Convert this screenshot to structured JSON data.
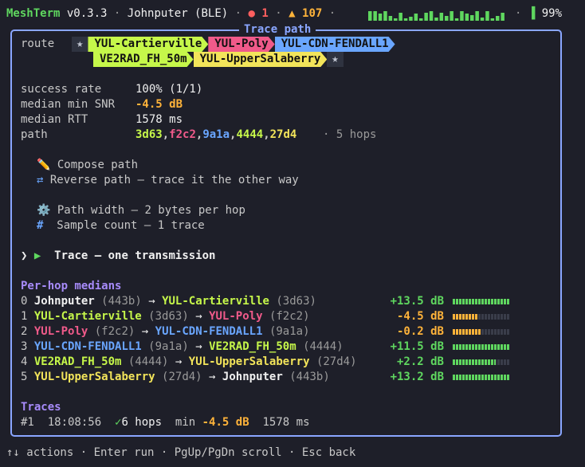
{
  "header": {
    "app": "MeshTerm",
    "version": "v0.3.3",
    "device": "Johnputer (BLE)",
    "errors": "1",
    "warnings": "107",
    "battery": "99%"
  },
  "frame_title": "Trace path",
  "route": {
    "label": "route",
    "star": "★",
    "row1": [
      "YUL-Cartierville",
      "YUL-Poly",
      "YUL-CDN-FENDALL1"
    ],
    "row2": [
      "VE2RAD_FH_50m",
      "YUL-UpperSalaberry"
    ]
  },
  "stats": {
    "success_label": "success rate",
    "success_value": "100% (1/1)",
    "snr_label": "median min SNR",
    "snr_value": "-4.5 dB",
    "rtt_label": "median RTT",
    "rtt_value": "1578 ms",
    "path_label": "path",
    "path_ids": [
      "3d63",
      "f2c2",
      "9a1a",
      "4444",
      "27d4"
    ],
    "hops_text": "· 5 hops"
  },
  "actions": {
    "compose": "Compose path",
    "reverse": "Reverse path — trace it the other way",
    "width": "Path width — 2 bytes per hop",
    "count": "Sample count — 1 trace",
    "trace": "Trace — one transmission"
  },
  "perhop": {
    "title": "Per-hop medians",
    "rows": [
      {
        "idx": "0",
        "from": "Johnputer",
        "fid": "(443b)",
        "to": "YUL-Cartierville",
        "tid": "(3d63)",
        "snr": "+13.5 dB",
        "level": 1.0
      },
      {
        "idx": "1",
        "from": "YUL-Cartierville",
        "fid": "(3d63)",
        "to": "YUL-Poly",
        "tid": "(f2c2)",
        "snr": "-4.5 dB",
        "level": 0.45
      },
      {
        "idx": "2",
        "from": "YUL-Poly",
        "fid": "(f2c2)",
        "to": "YUL-CDN-FENDALL1",
        "tid": "(9a1a)",
        "snr": "-0.2 dB",
        "level": 0.5
      },
      {
        "idx": "3",
        "from": "YUL-CDN-FENDALL1",
        "fid": "(9a1a)",
        "to": "VE2RAD_FH_50m",
        "tid": "(4444)",
        "snr": "+11.5 dB",
        "level": 1.0
      },
      {
        "idx": "4",
        "from": "VE2RAD_FH_50m",
        "fid": "(4444)",
        "to": "YUL-UpperSalaberry",
        "tid": "(27d4)",
        "snr": "+2.2 dB",
        "level": 0.75
      },
      {
        "idx": "5",
        "from": "YUL-UpperSalaberry",
        "fid": "(27d4)",
        "to": "Johnputer",
        "tid": "(443b)",
        "snr": "+13.2 dB",
        "level": 1.0
      }
    ]
  },
  "traces": {
    "title": "Traces",
    "rows": [
      {
        "num": "#1",
        "time": "18:08:56",
        "hops": "6 hops",
        "min_label": "min",
        "min_value": "-4.5 dB",
        "rtt": "1578 ms"
      }
    ]
  },
  "footer": "↑↓ actions · Enter run · PgUp/PgDn scroll · Esc back"
}
